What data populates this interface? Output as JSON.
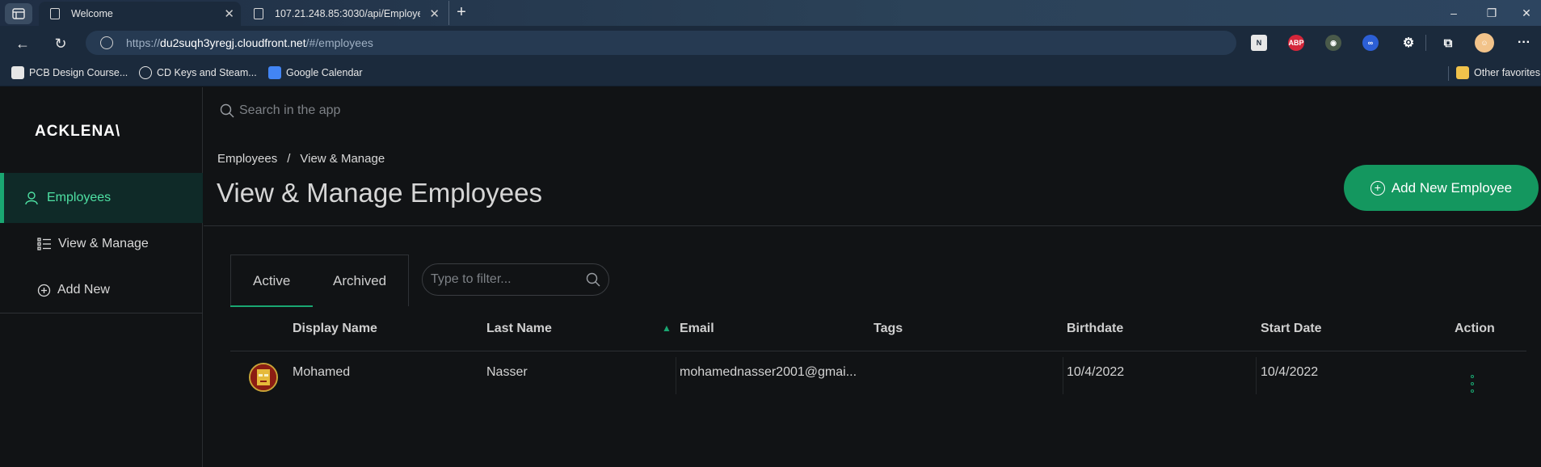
{
  "browser": {
    "tabs": [
      {
        "title": "Welcome"
      },
      {
        "title": "107.21.248.85:3030/api/Employe"
      }
    ],
    "url_scheme": "https://",
    "url_host": "du2suqh3yregj.cloudfront.net",
    "url_path": "/#/employees",
    "bookmarks": [
      {
        "label": "PCB Design Course..."
      },
      {
        "label": "CD Keys and Steam..."
      },
      {
        "label": "Google Calendar"
      }
    ],
    "other_favorites": "Other favorites",
    "accent_color": "#1aa772"
  },
  "app": {
    "logo": "ACKLENA\\",
    "sidebar": {
      "section": "Employees",
      "items": [
        {
          "label": "View & Manage"
        },
        {
          "label": "Add New"
        }
      ]
    },
    "search_placeholder": "Search in the app",
    "breadcrumb": {
      "first": "Employees",
      "separator": "/",
      "second": "View & Manage"
    },
    "page_title": "View & Manage Employees",
    "add_button": "Add New Employee",
    "tabs": {
      "active": "Active",
      "archived": "Archived"
    },
    "filter_placeholder": "Type to filter...",
    "table": {
      "sort_indicator": "▲",
      "columns": {
        "display_name": "Display Name",
        "last_name": "Last Name",
        "email": "Email",
        "tags": "Tags",
        "birthdate": "Birthdate",
        "start_date": "Start Date",
        "action": "Action"
      },
      "rows": [
        {
          "display_name": "Mohamed",
          "last_name": "Nasser",
          "email": "mohamednasser2001@gmai...",
          "tags": "",
          "birthdate": "10/4/2022",
          "start_date": "10/4/2022"
        }
      ]
    }
  }
}
